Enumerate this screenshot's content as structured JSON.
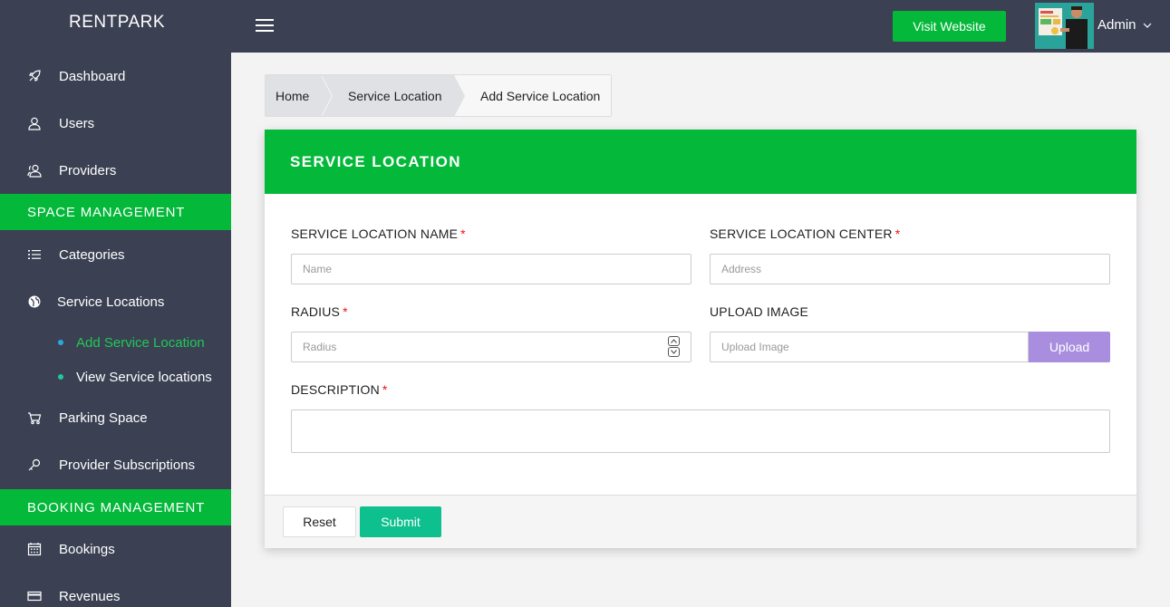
{
  "brand": "RENTPARK",
  "sidebar": {
    "items": [
      {
        "label": "Dashboard",
        "icon": "rocket-icon"
      },
      {
        "label": "Users",
        "icon": "user-icon"
      },
      {
        "label": "Providers",
        "icon": "users-icon"
      },
      {
        "label": "Categories",
        "icon": "list-icon"
      },
      {
        "label": "Service Locations",
        "icon": "globe-icon"
      },
      {
        "label": "Parking Space",
        "icon": "cart-icon"
      },
      {
        "label": "Provider Subscriptions",
        "icon": "key-icon"
      },
      {
        "label": "Bookings",
        "icon": "calendar-icon"
      },
      {
        "label": "Revenues",
        "icon": "credit-card-icon"
      }
    ],
    "sections": [
      "SPACE MANAGEMENT",
      "BOOKING MANAGEMENT"
    ],
    "sub_items": [
      {
        "label": "Add Service Location",
        "active": true,
        "dot_color": "#2aa9e0"
      },
      {
        "label": "View Service locations",
        "active": false,
        "dot_color": "#1fc99a"
      }
    ]
  },
  "topbar": {
    "visit_label": "Visit Website",
    "user_name": "Admin"
  },
  "breadcrumb": [
    "Home",
    "Service Location",
    "Add Service Location"
  ],
  "form": {
    "title": "SERVICE LOCATION",
    "name_label": "SERVICE LOCATION NAME",
    "name_placeholder": "Name",
    "center_label": "SERVICE LOCATION CENTER",
    "center_placeholder": "Address",
    "radius_label": "RADIUS",
    "radius_placeholder": "Radius",
    "image_label": "UPLOAD IMAGE",
    "image_placeholder": "Upload Image",
    "upload_label": "Upload",
    "description_label": "DESCRIPTION",
    "required_mark": "*",
    "reset_label": "Reset",
    "submit_label": "Submit"
  },
  "colors": {
    "sidebar_bg": "#3b4153",
    "accent_green": "#04b83a",
    "submit_teal": "#0ec08e",
    "upload_purple": "#a98ee0"
  }
}
